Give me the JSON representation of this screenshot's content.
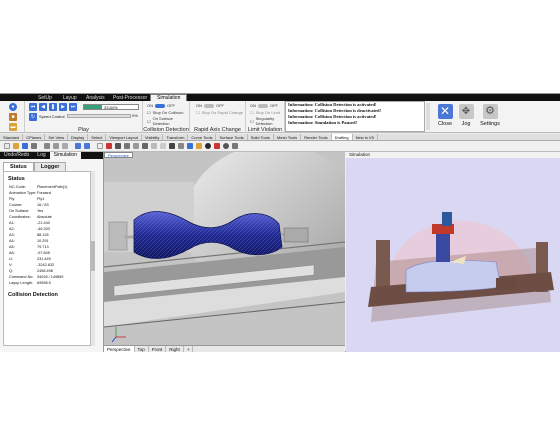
{
  "ribbon_tabs": [
    "SetUp",
    "Layup",
    "Analysis",
    "Post-Processor",
    "Simulation"
  ],
  "play": {
    "percent": "33.84%",
    "speed_label": "Speed Control",
    "speed_value": "0%",
    "group_label": "Play"
  },
  "collision": {
    "on": "ON",
    "off": "OFF",
    "stop": "Stop On Collision",
    "surface": "On Surface Detection",
    "group_label": "Collision Detection"
  },
  "rapid": {
    "on": "ON",
    "off": "OFF",
    "stop": "Stop On Rapid Change",
    "group_label": "Rapid Axis Change"
  },
  "limit": {
    "on": "ON",
    "off": "OFF",
    "stop": "Stop On Limit",
    "singularity": "Singularity Detection",
    "group_label": "Limit Violation"
  },
  "messages": [
    "Information: Collision Detection is activated!",
    "Information: Collision Detection is deactivated!",
    "Information: Collision Detection is activated!",
    "Information: Simulation is Paused!"
  ],
  "buttons": {
    "close": "Close",
    "jog": "Jog",
    "settings": "Settings"
  },
  "toolbar_tabs": [
    "Standard",
    "CPlanes",
    "Set View",
    "Display",
    "Select",
    "Viewport Layout",
    "Visibility",
    "Transform",
    "Curve Tools",
    "Surface Tools",
    "Solid Tools",
    "Mesh Tools",
    "Render Tools",
    "Drafting",
    "New in V5"
  ],
  "panel_tabs": [
    "Undo/Redo",
    "Log",
    "Simulation"
  ],
  "status_tabs": [
    "Status",
    "Logger"
  ],
  "status": {
    "heading": "Status",
    "rows": [
      {
        "k": "NC-Code:",
        "v": "PlacementPath(1)"
      },
      {
        "k": "Animation Type:",
        "v": "Forward"
      },
      {
        "k": "Ply:",
        "v": "Ply1"
      },
      {
        "k": "Course:",
        "v": "16 / 83"
      },
      {
        "k": "On Surface:",
        "v": "Yes"
      },
      {
        "k": "Coordinates:",
        "v": "Absolute"
      },
      {
        "k": "A1:",
        "v": "-21.440"
      },
      {
        "k": "A2:",
        "v": "-46.333"
      },
      {
        "k": "A3:",
        "v": "88.126"
      },
      {
        "k": "A4:",
        "v": "10.291"
      },
      {
        "k": "A5:",
        "v": "79.713"
      },
      {
        "k": "A6:",
        "v": "-97.845"
      },
      {
        "k": "U:",
        "v": "231.449"
      },
      {
        "k": "V:",
        "v": "-3242.632"
      },
      {
        "k": "Q:",
        "v": "2458.498"
      },
      {
        "k": "Command No:",
        "v": "34028 / 149859"
      },
      {
        "k": "Layup Length:",
        "v": "69598.5"
      }
    ],
    "collision_heading": "Collision Detection"
  },
  "viewport": {
    "label": "Perspective",
    "tabs": [
      "Perspective",
      "Top",
      "Front",
      "Right",
      "+"
    ]
  },
  "simulation": {
    "label": "Simulation"
  },
  "colors": {
    "accent": "#3a6fd8",
    "mandrel": "#2a33a8",
    "ribbon_bg": "#f3f3f3"
  }
}
